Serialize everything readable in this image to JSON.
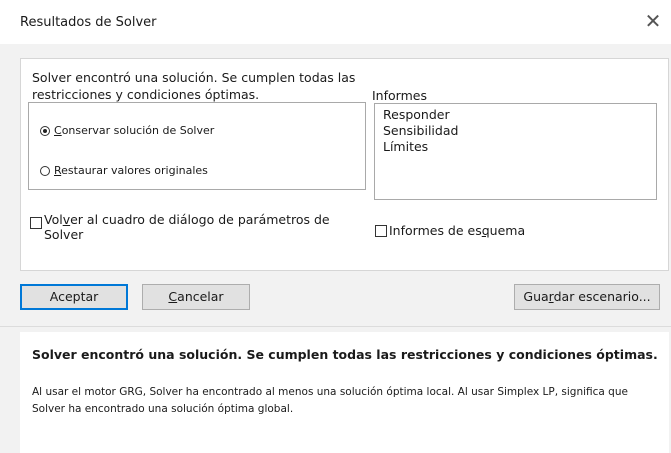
{
  "window": {
    "title": "Resultados de Solver",
    "close_glyph": "✕"
  },
  "main": {
    "message": "Solver encontró una solución. Se cumplen todas las restricciones y condiciones óptimas.",
    "options": [
      {
        "pre": "",
        "ul": "C",
        "post": "onservar solución de Solver",
        "checked": true
      },
      {
        "pre": "",
        "ul": "R",
        "post": "estaurar valores originales",
        "checked": false
      }
    ],
    "reports_label": "Informes",
    "reports": [
      "Responder",
      "Sensibilidad",
      "Límites"
    ],
    "return_checkbox": {
      "pre": "Vol",
      "ul": "v",
      "post": "er al cuadro de diálogo de parámetros de Solver"
    },
    "outline_checkbox": {
      "pre": "Informes de es",
      "ul": "q",
      "post": "uema"
    }
  },
  "buttons": {
    "accept": {
      "pre": "Aceptar",
      "ul": "",
      "post": ""
    },
    "cancel": {
      "pre": "",
      "ul": "C",
      "post": "ancelar"
    },
    "save": {
      "pre": "Gua",
      "ul": "r",
      "post": "dar escenario..."
    }
  },
  "description": {
    "headline": "Solver encontró una solución. Se cumplen todas las restricciones y condiciones óptimas.",
    "body": "Al usar el motor GRG, Solver ha encontrado al menos una solución óptima local. Al usar Simplex LP, significa que Solver ha encontrado una solución óptima global."
  }
}
